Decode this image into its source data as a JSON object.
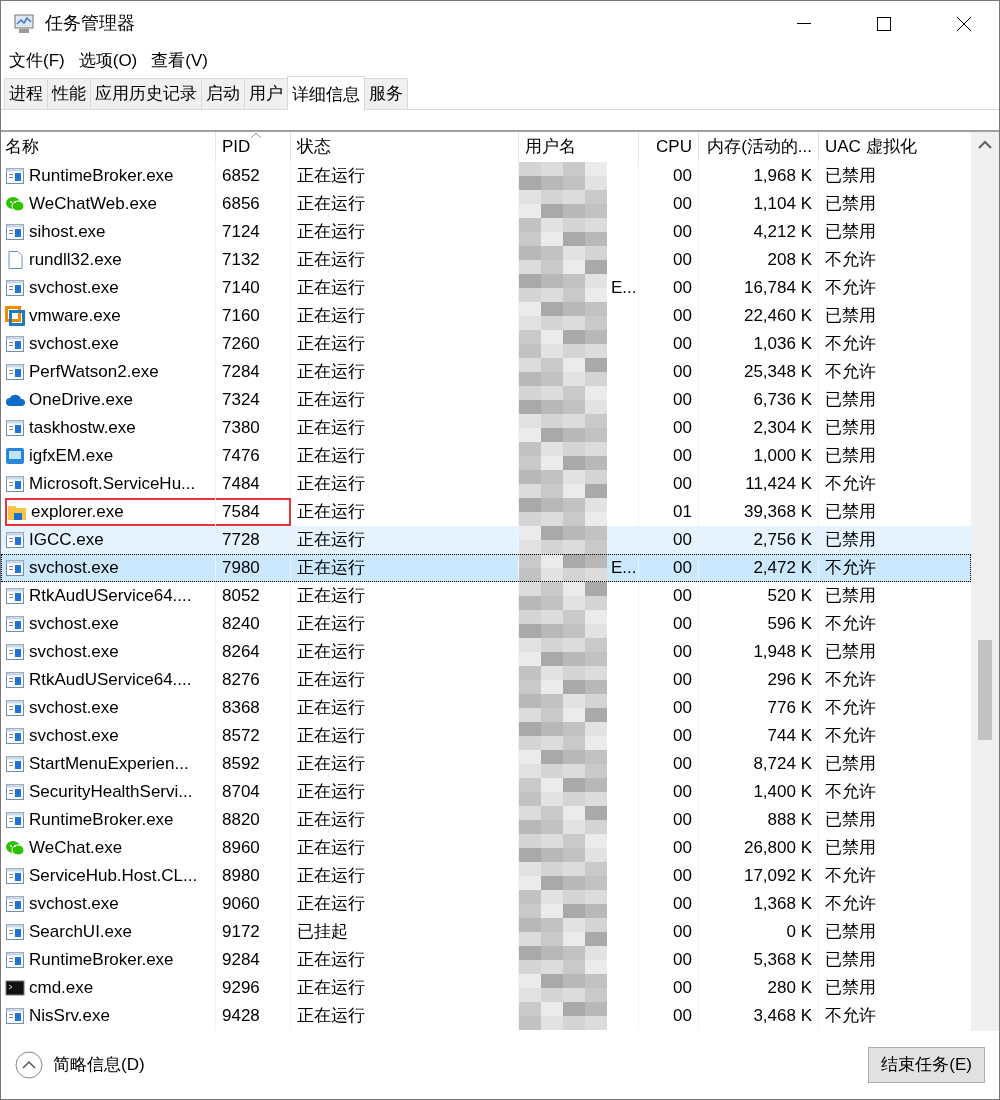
{
  "window": {
    "title": "任务管理器"
  },
  "menu": [
    "文件(F)",
    "选项(O)",
    "查看(V)"
  ],
  "tabs": [
    {
      "label": "进程",
      "selected": false
    },
    {
      "label": "性能",
      "selected": false
    },
    {
      "label": "应用历史记录",
      "selected": false
    },
    {
      "label": "启动",
      "selected": false
    },
    {
      "label": "用户",
      "selected": false
    },
    {
      "label": "详细信息",
      "selected": true
    },
    {
      "label": "服务",
      "selected": false
    }
  ],
  "table": {
    "columns": [
      {
        "label": "名称",
        "sorted": false
      },
      {
        "label": "PID",
        "sorted": true
      },
      {
        "label": "状态",
        "sorted": false
      },
      {
        "label": "用户名",
        "sorted": false
      },
      {
        "label": "CPU",
        "sorted": false
      },
      {
        "label": "内存(活动的...",
        "sorted": false
      },
      {
        "label": "UAC 虚拟化",
        "sorted": false
      }
    ],
    "rows": [
      {
        "kind": "app",
        "name": "RuntimeBroker.exe",
        "pid": "6852",
        "status": "正在运行",
        "cpu": "00",
        "memory": "1,968 K",
        "uac": "已禁用",
        "selected": false,
        "hovered": false,
        "outlined": false
      },
      {
        "kind": "wechat",
        "name": "WeChatWeb.exe",
        "pid": "6856",
        "status": "正在运行",
        "cpu": "00",
        "memory": "1,104 K",
        "uac": "已禁用",
        "selected": false,
        "hovered": false,
        "outlined": false
      },
      {
        "kind": "app",
        "name": "sihost.exe",
        "pid": "7124",
        "status": "正在运行",
        "cpu": "00",
        "memory": "4,212 K",
        "uac": "已禁用",
        "selected": false,
        "hovered": false,
        "outlined": false
      },
      {
        "kind": "file",
        "name": "rundll32.exe",
        "pid": "7132",
        "status": "正在运行",
        "cpu": "00",
        "memory": "208 K",
        "uac": "不允许",
        "selected": false,
        "hovered": false,
        "outlined": false
      },
      {
        "kind": "app",
        "name": "svchost.exe",
        "pid": "7140",
        "status": "正在运行",
        "user": "E...",
        "cpu": "00",
        "memory": "16,784 K",
        "uac": "不允许",
        "selected": false,
        "hovered": false,
        "outlined": false
      },
      {
        "kind": "vmware",
        "name": "vmware.exe",
        "pid": "7160",
        "status": "正在运行",
        "cpu": "00",
        "memory": "22,460 K",
        "uac": "已禁用",
        "selected": false,
        "hovered": false,
        "outlined": false
      },
      {
        "kind": "app",
        "name": "svchost.exe",
        "pid": "7260",
        "status": "正在运行",
        "cpu": "00",
        "memory": "1,036 K",
        "uac": "不允许",
        "selected": false,
        "hovered": false,
        "outlined": false
      },
      {
        "kind": "app",
        "name": "PerfWatson2.exe",
        "pid": "7284",
        "status": "正在运行",
        "cpu": "00",
        "memory": "25,348 K",
        "uac": "不允许",
        "selected": false,
        "hovered": false,
        "outlined": false
      },
      {
        "kind": "cloud",
        "name": "OneDrive.exe",
        "pid": "7324",
        "status": "正在运行",
        "cpu": "00",
        "memory": "6,736 K",
        "uac": "已禁用",
        "selected": false,
        "hovered": false,
        "outlined": false
      },
      {
        "kind": "app",
        "name": "taskhostw.exe",
        "pid": "7380",
        "status": "正在运行",
        "cpu": "00",
        "memory": "2,304 K",
        "uac": "已禁用",
        "selected": false,
        "hovered": false,
        "outlined": false
      },
      {
        "kind": "monitor",
        "name": "igfxEM.exe",
        "pid": "7476",
        "status": "正在运行",
        "cpu": "00",
        "memory": "1,000 K",
        "uac": "已禁用",
        "selected": false,
        "hovered": false,
        "outlined": false
      },
      {
        "kind": "app",
        "name": "Microsoft.ServiceHu...",
        "pid": "7484",
        "status": "正在运行",
        "cpu": "00",
        "memory": "11,424 K",
        "uac": "不允许",
        "selected": false,
        "hovered": false,
        "outlined": false
      },
      {
        "kind": "folder",
        "name": "explorer.exe",
        "pid": "7584",
        "status": "正在运行",
        "cpu": "01",
        "memory": "39,368 K",
        "uac": "已禁用",
        "selected": false,
        "hovered": false,
        "outlined": true
      },
      {
        "kind": "app",
        "name": "IGCC.exe",
        "pid": "7728",
        "status": "正在运行",
        "cpu": "00",
        "memory": "2,756 K",
        "uac": "已禁用",
        "selected": false,
        "hovered": true,
        "outlined": false
      },
      {
        "kind": "app",
        "name": "svchost.exe",
        "pid": "7980",
        "status": "正在运行",
        "user": "E...",
        "cpu": "00",
        "memory": "2,472 K",
        "uac": "不允许",
        "selected": true,
        "hovered": false,
        "outlined": false
      },
      {
        "kind": "app",
        "name": "RtkAudUService64....",
        "pid": "8052",
        "status": "正在运行",
        "cpu": "00",
        "memory": "520 K",
        "uac": "已禁用",
        "selected": false,
        "hovered": false,
        "outlined": false
      },
      {
        "kind": "app",
        "name": "svchost.exe",
        "pid": "8240",
        "status": "正在运行",
        "cpu": "00",
        "memory": "596 K",
        "uac": "不允许",
        "selected": false,
        "hovered": false,
        "outlined": false
      },
      {
        "kind": "app",
        "name": "svchost.exe",
        "pid": "8264",
        "status": "正在运行",
        "cpu": "00",
        "memory": "1,948 K",
        "uac": "已禁用",
        "selected": false,
        "hovered": false,
        "outlined": false
      },
      {
        "kind": "app",
        "name": "RtkAudUService64....",
        "pid": "8276",
        "status": "正在运行",
        "cpu": "00",
        "memory": "296 K",
        "uac": "不允许",
        "selected": false,
        "hovered": false,
        "outlined": false
      },
      {
        "kind": "app",
        "name": "svchost.exe",
        "pid": "8368",
        "status": "正在运行",
        "cpu": "00",
        "memory": "776 K",
        "uac": "不允许",
        "selected": false,
        "hovered": false,
        "outlined": false
      },
      {
        "kind": "app",
        "name": "svchost.exe",
        "pid": "8572",
        "status": "正在运行",
        "cpu": "00",
        "memory": "744 K",
        "uac": "不允许",
        "selected": false,
        "hovered": false,
        "outlined": false
      },
      {
        "kind": "app",
        "name": "StartMenuExperien...",
        "pid": "8592",
        "status": "正在运行",
        "cpu": "00",
        "memory": "8,724 K",
        "uac": "已禁用",
        "selected": false,
        "hovered": false,
        "outlined": false
      },
      {
        "kind": "app",
        "name": "SecurityHealthServi...",
        "pid": "8704",
        "status": "正在运行",
        "cpu": "00",
        "memory": "1,400 K",
        "uac": "不允许",
        "selected": false,
        "hovered": false,
        "outlined": false
      },
      {
        "kind": "app",
        "name": "RuntimeBroker.exe",
        "pid": "8820",
        "status": "正在运行",
        "cpu": "00",
        "memory": "888 K",
        "uac": "已禁用",
        "selected": false,
        "hovered": false,
        "outlined": false
      },
      {
        "kind": "wechat",
        "name": "WeChat.exe",
        "pid": "8960",
        "status": "正在运行",
        "cpu": "00",
        "memory": "26,800 K",
        "uac": "已禁用",
        "selected": false,
        "hovered": false,
        "outlined": false
      },
      {
        "kind": "app",
        "name": "ServiceHub.Host.CL...",
        "pid": "8980",
        "status": "正在运行",
        "cpu": "00",
        "memory": "17,092 K",
        "uac": "不允许",
        "selected": false,
        "hovered": false,
        "outlined": false
      },
      {
        "kind": "app",
        "name": "svchost.exe",
        "pid": "9060",
        "status": "正在运行",
        "cpu": "00",
        "memory": "1,368 K",
        "uac": "不允许",
        "selected": false,
        "hovered": false,
        "outlined": false
      },
      {
        "kind": "app",
        "name": "SearchUI.exe",
        "pid": "9172",
        "status": "已挂起",
        "cpu": "00",
        "memory": "0 K",
        "uac": "已禁用",
        "selected": false,
        "hovered": false,
        "outlined": false
      },
      {
        "kind": "app",
        "name": "RuntimeBroker.exe",
        "pid": "9284",
        "status": "正在运行",
        "cpu": "00",
        "memory": "5,368 K",
        "uac": "已禁用",
        "selected": false,
        "hovered": false,
        "outlined": false
      },
      {
        "kind": "console",
        "name": "cmd.exe",
        "pid": "9296",
        "status": "正在运行",
        "cpu": "00",
        "memory": "280 K",
        "uac": "已禁用",
        "selected": false,
        "hovered": false,
        "outlined": false
      },
      {
        "kind": "app",
        "name": "NisSrv.exe",
        "pid": "9428",
        "status": "正在运行",
        "cpu": "00",
        "memory": "3,468 K",
        "uac": "不允许",
        "selected": false,
        "hovered": false,
        "outlined": false
      }
    ]
  },
  "footer": {
    "details_toggle": "简略信息(D)",
    "end_task_button": "结束任务(E)"
  }
}
